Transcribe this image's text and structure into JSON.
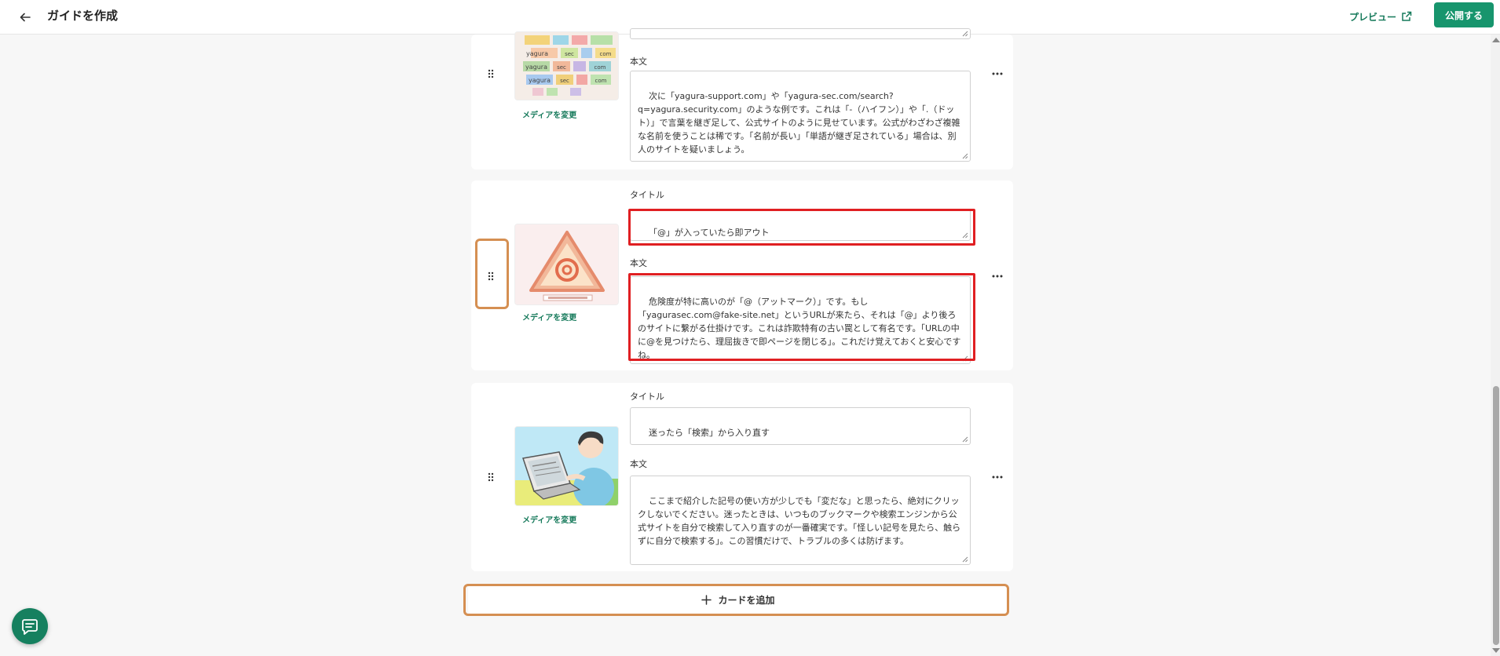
{
  "header": {
    "title": "ガイドを作成",
    "preview_label": "プレビュー",
    "publish_label": "公開する"
  },
  "cards": [
    {
      "body_label": "本文",
      "body": "次に「yagura-support.com」や「yagura-sec.com/search?q=yagura.security.com」のような例です。これは「-（ハイフン）」や「.（ドット）」で言葉を継ぎ足して、公式サイトのように見せています。公式がわざわざ複雑な名前を使うことは稀です。「名前が長い」「単語が継ぎ足されている」場合は、別人のサイトを疑いましょう。",
      "change_media": "メディアを変更",
      "image_text": [
        "yagura",
        "sec",
        "com"
      ]
    },
    {
      "title_label": "タイトル",
      "title": "「@」が入っていたら即アウト",
      "body_label": "本文",
      "body": "危険度が特に高いのが「@（アットマーク）」です。もし「yagurasec.com@fake-site.net」というURLが来たら、それは「@」より後ろのサイトに繋がる仕掛けです。これは詐欺特有の古い罠として有名です。「URLの中に@を見つけたら、理屈抜きで即ページを閉じる」。これだけ覚えておくと安心ですね。",
      "change_media": "メディアを変更"
    },
    {
      "title_label": "タイトル",
      "title": "迷ったら「検索」から入り直す",
      "body_label": "本文",
      "body": "ここまで紹介した記号の使い方が少しでも「変だな」と思ったら、絶対にクリックしないでください。迷ったときは、いつものブックマークや検索エンジンから公式サイトを自分で検索して入り直すのが一番確実です。「怪しい記号を見たら、触らずに自分で検索する」。この習慣だけで、トラブルの多くは防げます。",
      "change_media": "メディアを変更"
    }
  ],
  "add_card_label": "カードを追加",
  "colors": {
    "brand_green": "#17956d",
    "highlight_red": "#e01f22",
    "highlight_orange": "#d58f52"
  }
}
